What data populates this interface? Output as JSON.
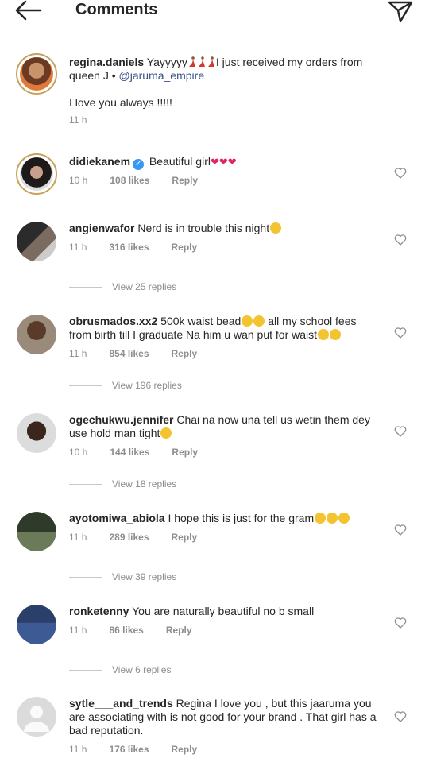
{
  "header": {
    "title": "Comments"
  },
  "caption": {
    "username": "regina.daniels",
    "text_part1": "Yayyyyy",
    "text_part2": "I just received my orders from queen J •",
    "mention": "@jaruma_empire",
    "text_part3": "I love you always !!!!!",
    "time": "11 h"
  },
  "comments": [
    {
      "username": "didiekanem",
      "text": "Beautiful girl",
      "time": "10 h",
      "likes": "108 likes",
      "reply": "Reply"
    },
    {
      "username": "angienwafor",
      "text": "Nerd is in trouble this night",
      "time": "11 h",
      "likes": "316 likes",
      "reply": "Reply",
      "replies": "View 25 replies"
    },
    {
      "username": "obrusmados.xx2",
      "text1": "500k waist bead",
      "text2": "all my school fees from birth till I graduate Na him u wan put for waist",
      "time": "11 h",
      "likes": "854 likes",
      "reply": "Reply",
      "replies": "View 196 replies"
    },
    {
      "username": "ogechukwu.jennifer",
      "text": "Chai na now una tell us wetin them dey use hold man tight",
      "time": "10 h",
      "likes": "144 likes",
      "reply": "Reply",
      "replies": "View 18 replies"
    },
    {
      "username": "ayotomiwa_abiola",
      "text": "I hope this is just for the gram",
      "time": "11 h",
      "likes": "289 likes",
      "reply": "Reply",
      "replies": "View 39 replies"
    },
    {
      "username": "ronketenny",
      "text": "You are naturally beautiful no b small",
      "time": "11 h",
      "likes": "86 likes",
      "reply": "Reply",
      "replies": "View 6 replies"
    },
    {
      "username": "sytle___and_trends",
      "text": "Regina I love you , but this jaaruma you are associating with is not good for your brand . That girl has a bad reputation.",
      "time": "11 h",
      "likes": "176 likes",
      "reply": "Reply"
    }
  ],
  "colors": {
    "mention": "#385185",
    "secondary_text": "#8e8e8e",
    "story_ring": "#c6a25a"
  },
  "icons": [
    "back-arrow-icon",
    "send-icon",
    "heart-outline-icon",
    "verified-badge-icon"
  ]
}
